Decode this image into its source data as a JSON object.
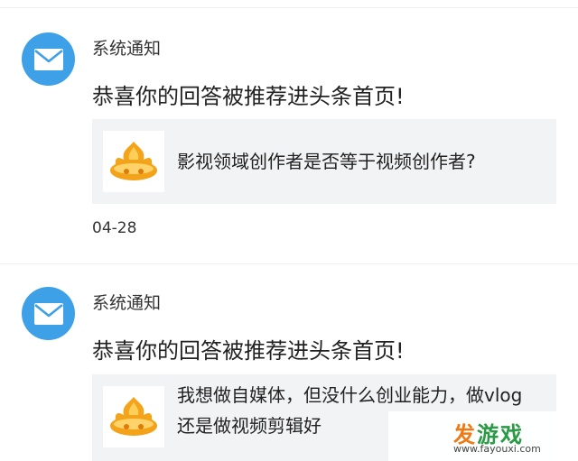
{
  "notifications": [
    {
      "sender": "系统通知",
      "headline": "恭喜你的回答被推荐进头条首页!",
      "card_title": "影视领域创作者是否等于视频创作者?",
      "date": "04-28",
      "icon": "mail-icon"
    },
    {
      "sender": "系统通知",
      "headline": "恭喜你的回答被推荐进头条首页!",
      "card_title": "我想做自媒体，但没什么创业能力，做vlog还是做视频剪辑好",
      "icon": "mail-icon"
    }
  ],
  "watermark": {
    "logo_first": "发",
    "logo_rest": "游戏",
    "url": "www.fayouxi.com"
  },
  "colors": {
    "avatar_blue": "#3ea0e6",
    "card_bg": "#f2f3f5",
    "thumb_gold": "#f2a31a"
  }
}
